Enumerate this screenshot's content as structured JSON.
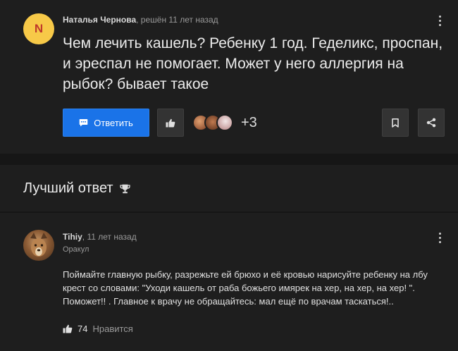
{
  "question": {
    "avatar_letter": "N",
    "author": "Наталья Чернова",
    "meta": ", решён 11 лет назад",
    "title": "Чем лечить кашель? Ребенку 1 год. Геделикс, проспан, и эреспал не помогает. Может у него аллергия на рыбок? бывает такое",
    "answer_button_label": "Ответить",
    "likers_count": "+3"
  },
  "best_answer": {
    "section_title": "Лучший ответ",
    "author": "Tihiy",
    "meta": ", 11 лет назад",
    "rank": "Оракул",
    "text": "Поймайте главную рыбку, разрежьте ей брюхо и её кровью нарисуйте ребенку на лбу крест со словами: \"Уходи кашель от раба божьего имярек на хер, на хер, на хер! \". Поможет!! . Главное к врачу не обращайтесь: мал ещё по врачам таскаться!..",
    "likes_count": "74",
    "likes_label": "Нравится"
  },
  "colors": {
    "accent": "#1a73e8",
    "background": "#161616",
    "card": "#1e1e1e",
    "avatar_bg": "#f7c948",
    "avatar_letter": "#c0392b"
  },
  "icons": {
    "question_menu": "kebab-icon",
    "answer_menu": "kebab-icon",
    "answer_button": "chat-bubble-icon",
    "like": "thumbs-up-icon",
    "bookmark": "bookmark-icon",
    "share": "share-icon",
    "best_answer": "trophy-icon"
  }
}
